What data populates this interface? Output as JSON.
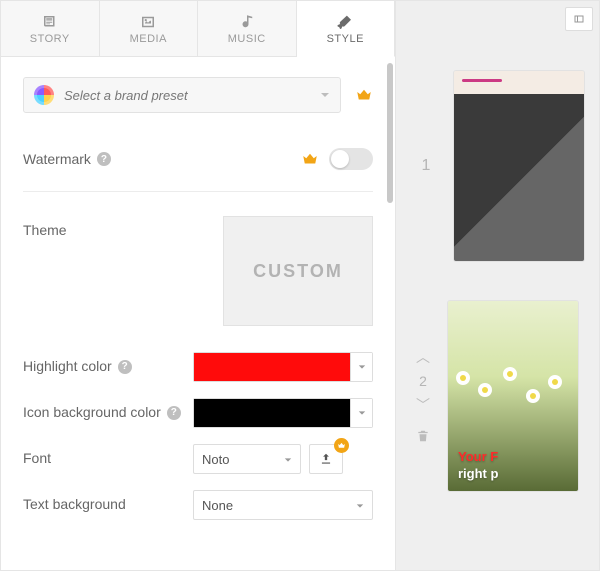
{
  "tabs": {
    "story": "STORY",
    "media": "MEDIA",
    "music": "MUSIC",
    "style": "STYLE"
  },
  "preset": {
    "placeholder": "Select a brand preset"
  },
  "watermark": {
    "label": "Watermark",
    "enabled": false
  },
  "theme": {
    "label": "Theme",
    "value": "CUSTOM"
  },
  "highlight": {
    "label": "Highlight color",
    "value": "#ff0b0b"
  },
  "icon_bg": {
    "label": "Icon background color",
    "value": "#000000"
  },
  "font": {
    "label": "Font",
    "value": "Noto"
  },
  "text_bg": {
    "label": "Text background",
    "value": "None"
  },
  "slides": {
    "s1_num": "1",
    "s2_num": "2",
    "s2_line1": "Your F",
    "s2_line2": "right p"
  },
  "help_glyph": "?"
}
